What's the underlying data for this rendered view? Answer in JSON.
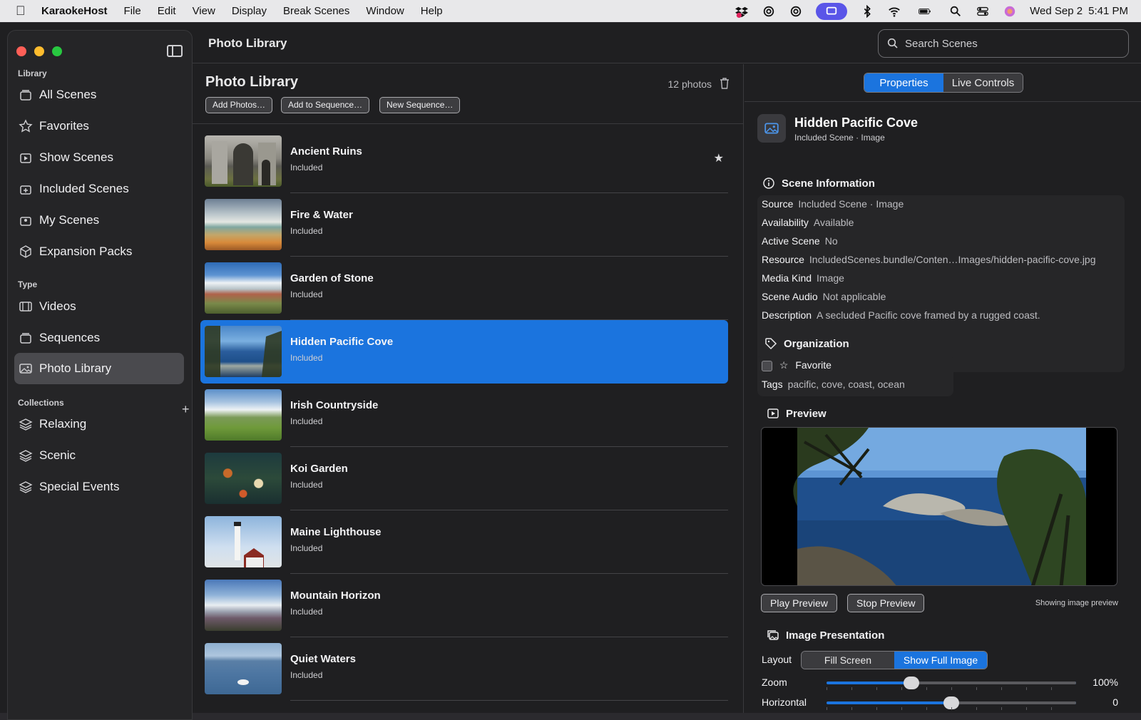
{
  "menubar": {
    "app": "KaraokeHost",
    "items": [
      "File",
      "Edit",
      "View",
      "Display",
      "Break Scenes",
      "Window",
      "Help"
    ],
    "date": "Wed Sep 2",
    "time": "5:41 PM"
  },
  "titlebar": {
    "title": "Photo Library",
    "search_placeholder": "Search Scenes"
  },
  "sidebar": {
    "library_header": "Library",
    "library": [
      {
        "label": "All Scenes",
        "icon": "stack-icon"
      },
      {
        "label": "Favorites",
        "icon": "star-icon"
      },
      {
        "label": "Show Scenes",
        "icon": "play-stack-icon"
      },
      {
        "label": "Included Scenes",
        "icon": "plus-stack-icon"
      },
      {
        "label": "My Scenes",
        "icon": "person-stack-icon"
      },
      {
        "label": "Expansion Packs",
        "icon": "box-icon"
      }
    ],
    "type_header": "Type",
    "type": [
      {
        "label": "Videos",
        "icon": "film-icon"
      },
      {
        "label": "Sequences",
        "icon": "stack-icon"
      },
      {
        "label": "Photo Library",
        "icon": "photo-icon",
        "selected": true
      }
    ],
    "collections_header": "Collections",
    "collections": [
      {
        "label": "Relaxing",
        "icon": "layers-icon"
      },
      {
        "label": "Scenic",
        "icon": "layers-icon"
      },
      {
        "label": "Special Events",
        "icon": "layers-icon"
      }
    ]
  },
  "list": {
    "title": "Photo Library",
    "count": "12 photos",
    "buttons": {
      "add_photos": "Add Photos…",
      "add_to_sequence": "Add to Sequence…",
      "new_sequence": "New Sequence…"
    },
    "rows": [
      {
        "name": "Ancient Ruins",
        "status": "Included",
        "favorite": true
      },
      {
        "name": "Fire & Water",
        "status": "Included"
      },
      {
        "name": "Garden of Stone",
        "status": "Included"
      },
      {
        "name": "Hidden Pacific Cove",
        "status": "Included",
        "selected": true
      },
      {
        "name": "Irish Countryside",
        "status": "Included"
      },
      {
        "name": "Koi Garden",
        "status": "Included"
      },
      {
        "name": "Maine Lighthouse",
        "status": "Included"
      },
      {
        "name": "Mountain Horizon",
        "status": "Included"
      },
      {
        "name": "Quiet Waters",
        "status": "Included"
      }
    ]
  },
  "inspector": {
    "tabs": {
      "properties": "Properties",
      "live_controls": "Live Controls"
    },
    "title": "Hidden Pacific Cove",
    "subtitle": "Included Scene · Image",
    "scene_info_title": "Scene Information",
    "info": [
      {
        "k": "Source",
        "v": "Included Scene · Image"
      },
      {
        "k": "Availability",
        "v": "Available"
      },
      {
        "k": "Active Scene",
        "v": "No"
      },
      {
        "k": "Resource",
        "v": "IncludedScenes.bundle/Conten…Images/hidden-pacific-cove.jpg"
      },
      {
        "k": "Media Kind",
        "v": "Image"
      },
      {
        "k": "Scene Audio",
        "v": "Not applicable"
      },
      {
        "k": "Description",
        "v": "A secluded Pacific cove framed by a rugged coast."
      }
    ],
    "organization_title": "Organization",
    "favorite_label": "Favorite",
    "tags_label": "Tags",
    "tags_value": "pacific, cove, coast, ocean",
    "preview_title": "Preview",
    "play_preview": "Play Preview",
    "stop_preview": "Stop Preview",
    "preview_note": "Showing image preview",
    "image_presentation_title": "Image Presentation",
    "layout_label": "Layout",
    "layout_options": {
      "fill": "Fill Screen",
      "full": "Show Full Image"
    },
    "zoom_label": "Zoom",
    "zoom_value": "100%",
    "zoom_fraction": 0.34,
    "horizontal_label": "Horizontal",
    "horizontal_value": "0",
    "horizontal_fraction": 0.5,
    "accent": "#1b74de"
  }
}
